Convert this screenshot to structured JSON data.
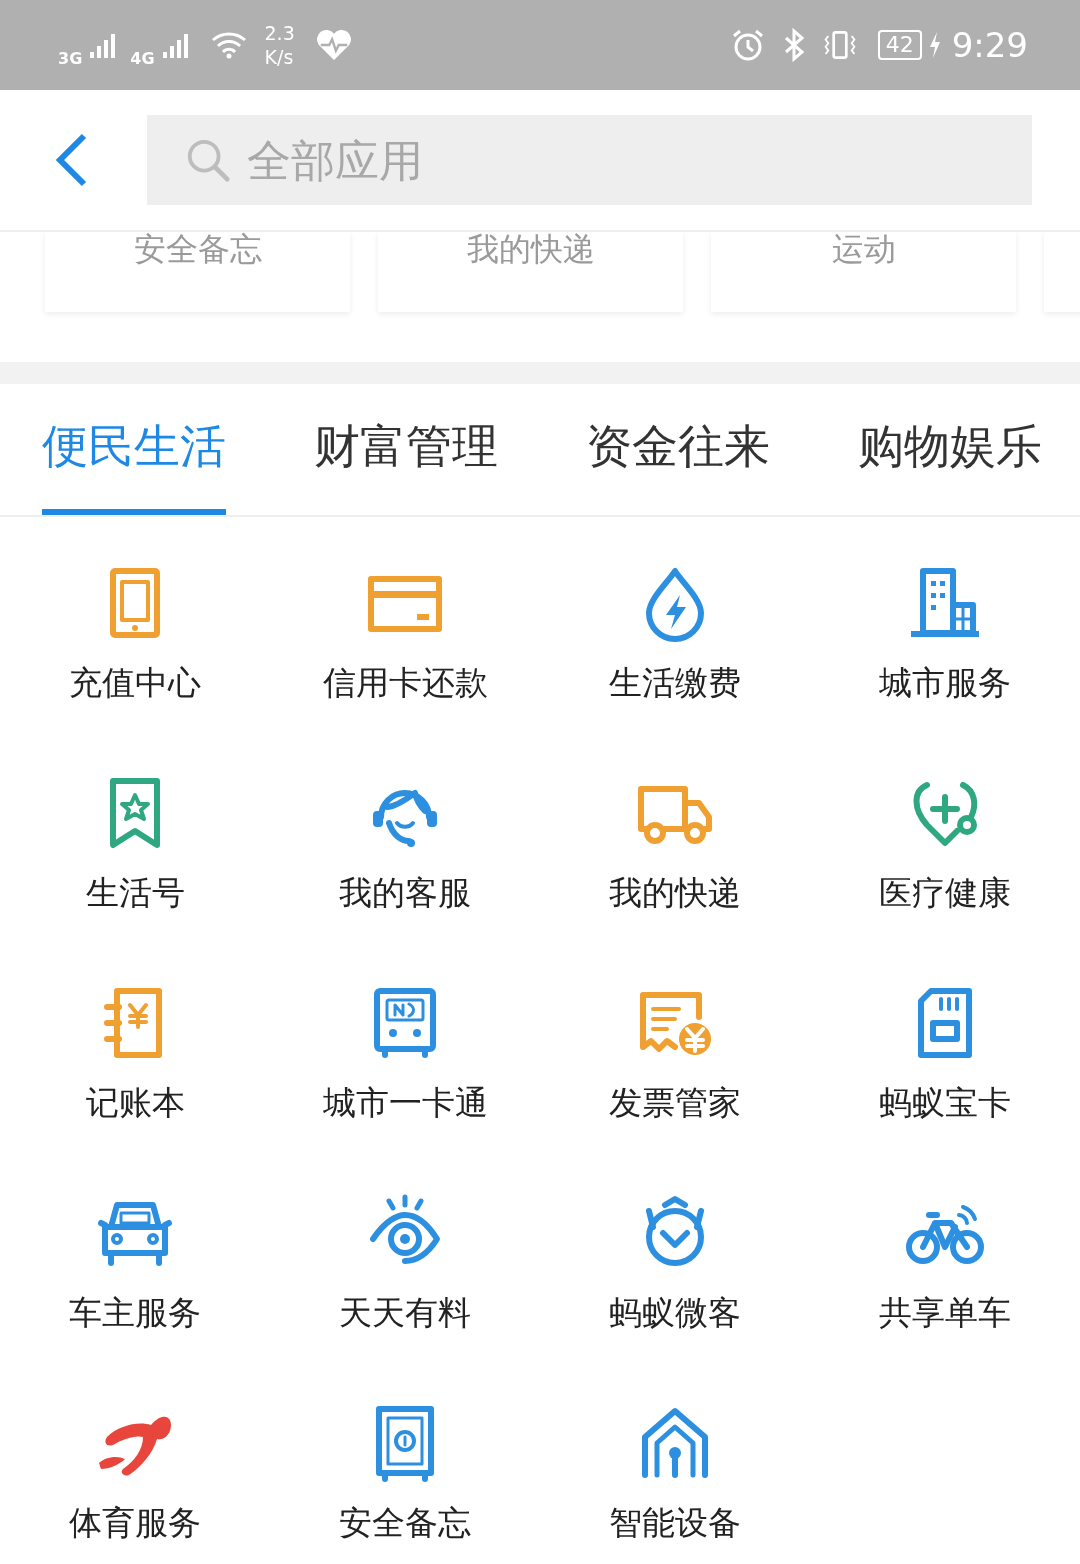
{
  "status_bar": {
    "network_1": "3G",
    "network_2": "4G",
    "speed_value": "2.3",
    "speed_unit": "K/s",
    "battery": "42",
    "time": "9:29"
  },
  "search": {
    "placeholder": "全部应用"
  },
  "recent_cards": [
    "安全备忘",
    "我的快递",
    "运动"
  ],
  "tabs": [
    {
      "label": "便民生活",
      "selected": true
    },
    {
      "label": "财富管理",
      "selected": false
    },
    {
      "label": "资金往来",
      "selected": false
    },
    {
      "label": "购物娱乐",
      "selected": false
    }
  ],
  "apps": [
    {
      "label": "充值中心",
      "kind": "tablet",
      "color": "#f0a030"
    },
    {
      "label": "信用卡还款",
      "kind": "card",
      "color": "#f0a030"
    },
    {
      "label": "生活缴费",
      "kind": "drop",
      "color": "#2d8fe0"
    },
    {
      "label": "城市服务",
      "kind": "building",
      "color": "#2d8fe0"
    },
    {
      "label": "生活号",
      "kind": "bookmark",
      "color": "#2fa882"
    },
    {
      "label": "我的客服",
      "kind": "headset",
      "color": "#2d8fe0"
    },
    {
      "label": "我的快递",
      "kind": "truck",
      "color": "#f0a030"
    },
    {
      "label": "医疗健康",
      "kind": "stethoscope",
      "color": "#2fa882"
    },
    {
      "label": "记账本",
      "kind": "ledger",
      "color": "#f0a030"
    },
    {
      "label": "城市一卡通",
      "kind": "transit",
      "color": "#2d8fe0"
    },
    {
      "label": "发票管家",
      "kind": "receipt",
      "color": "#f0a030"
    },
    {
      "label": "蚂蚁宝卡",
      "kind": "sim",
      "color": "#2d8fe0"
    },
    {
      "label": "车主服务",
      "kind": "car",
      "color": "#2d8fe0"
    },
    {
      "label": "天天有料",
      "kind": "eye",
      "color": "#2d8fe0"
    },
    {
      "label": "蚂蚁微客",
      "kind": "chevron",
      "color": "#2d8fe0"
    },
    {
      "label": "共享单车",
      "kind": "bike",
      "color": "#2d8fe0"
    },
    {
      "label": "体育服务",
      "kind": "swoosh",
      "color": "#e8453c"
    },
    {
      "label": "安全备忘",
      "kind": "safe",
      "color": "#2d8fe0"
    },
    {
      "label": "智能设备",
      "kind": "house",
      "color": "#2d8fe0"
    }
  ]
}
